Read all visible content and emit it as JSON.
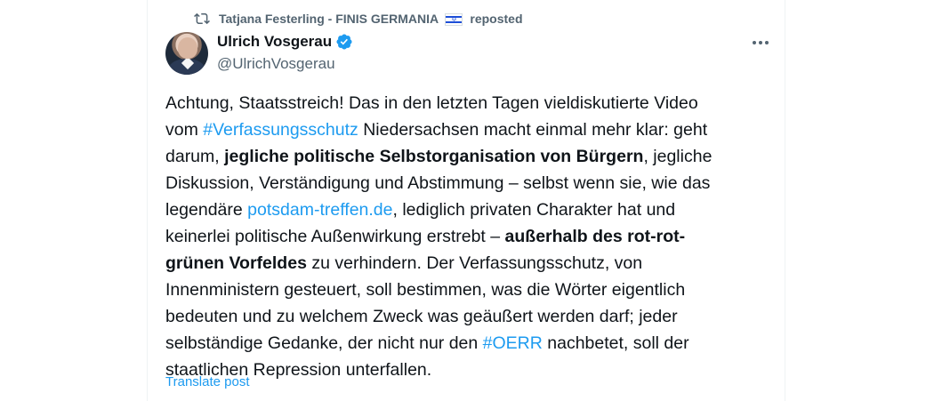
{
  "repost": {
    "user": "Tatjana Festerling - FINIS GERMANIA",
    "action": "reposted"
  },
  "author": {
    "name": "Ulrich Vosgerau",
    "handle": "@UlrichVosgerau",
    "verified": true
  },
  "post": {
    "segments": [
      {
        "text": "Achtung, Staatsstreich! Das in den letzten Tagen vieldiskutierte Video\nvom "
      },
      {
        "text": "#Verfassungsschutz",
        "type": "link"
      },
      {
        "text": " Niedersachsen macht einmal mehr klar: geht\ndarum, "
      },
      {
        "text": "jegliche politische Selbstorganisation von Bürgern",
        "type": "bold"
      },
      {
        "text": ", jegliche\nDiskussion, Verständigung und Abstimmung – selbst wenn sie, wie das\nlegendäre "
      },
      {
        "text": "potsdam-treffen.de",
        "type": "link"
      },
      {
        "text": ", lediglich privaten Charakter hat und\nkeinerlei politische Außenwirkung erstrebt – "
      },
      {
        "text": "außerhalb des rot-rot-\ngrünen Vorfeldes",
        "type": "bold"
      },
      {
        "text": " zu verhindern. Der Verfassungsschutz, von\nInnenministern gesteuert, soll bestimmen, was die Wörter eigentlich\nbedeuten und zu welchem Zweck was geäußert werden darf; jeder\nselbständige Gedanke, der nicht nur den "
      },
      {
        "text": "#OERR",
        "type": "link"
      },
      {
        "text": " nachbetet, soll der\nstaatlichen Repression unterfallen."
      }
    ],
    "translate_label": "Translate post"
  },
  "colors": {
    "link": "#1d9bf0",
    "secondary_text": "#536471",
    "verified": "#1d9bf0"
  },
  "icons": {
    "repost": "repost-icon",
    "flag": "israel-flag-icon",
    "verified": "verified-badge-icon",
    "more": "more-options-icon"
  }
}
